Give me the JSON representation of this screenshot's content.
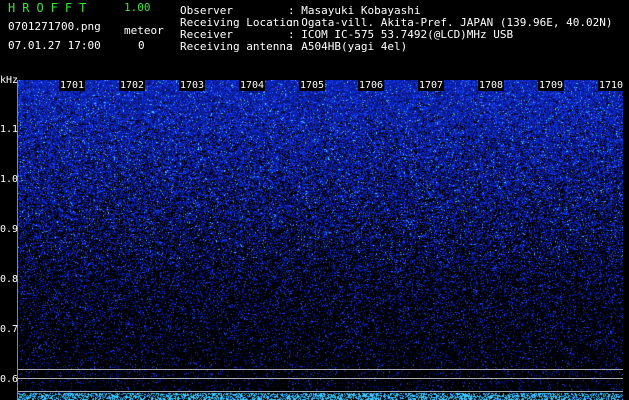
{
  "app": {
    "title": "HROFFT",
    "version": "1.00"
  },
  "file": {
    "name": "0701271700.png",
    "datetime": "07.01.27 17:00"
  },
  "meteor": {
    "label": "meteor",
    "count": "0"
  },
  "meta": [
    {
      "key": "Observer",
      "value": ": Masayuki Kobayashi"
    },
    {
      "key": "Receiving Location",
      "value": ": Ogata-vill. Akita-Pref. JAPAN (139.96E, 40.02N)"
    },
    {
      "key": "Receiver",
      "value": ": ICOM IC-575 53.7492(@LCD)MHz USB"
    },
    {
      "key": "Receiving antenna",
      "value": ": A504HB(yagi 4el)"
    }
  ],
  "axis": {
    "y_unit": "kHz",
    "y_ticks": [
      "1.1",
      "1.0",
      "0.9",
      "0.8",
      "0.7",
      "0.6"
    ],
    "x_ticks": [
      "1701",
      "1702",
      "1703",
      "1704",
      "1705",
      "1706",
      "1707",
      "1708",
      "1709",
      "1710"
    ]
  },
  "colors": {
    "accent": "#37e637",
    "signal": "#1a2cff",
    "noise_bright": "#4ad0ff"
  }
}
